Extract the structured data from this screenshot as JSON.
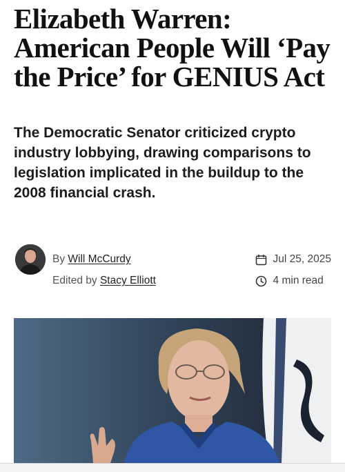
{
  "article": {
    "headline": "Elizabeth Warren: American People Will ‘Pay the Price’ for GENIUS Act",
    "subheadline": "The Democratic Senator criticized crypto industry lobbying, drawing comparisons to legislation implicated in the buildup to the 2008 financial crash."
  },
  "byline": {
    "by_prefix": "By",
    "author": "Will McCurdy",
    "edited_prefix": "Edited by",
    "editor": "Stacy Elliott",
    "avatar_icon": "author-avatar"
  },
  "meta": {
    "date": "Jul 25, 2025",
    "date_icon": "calendar-icon",
    "read_time": "4 min read",
    "read_time_icon": "clock-icon"
  },
  "hero": {
    "image_icon": "photo-of-speaker"
  }
}
